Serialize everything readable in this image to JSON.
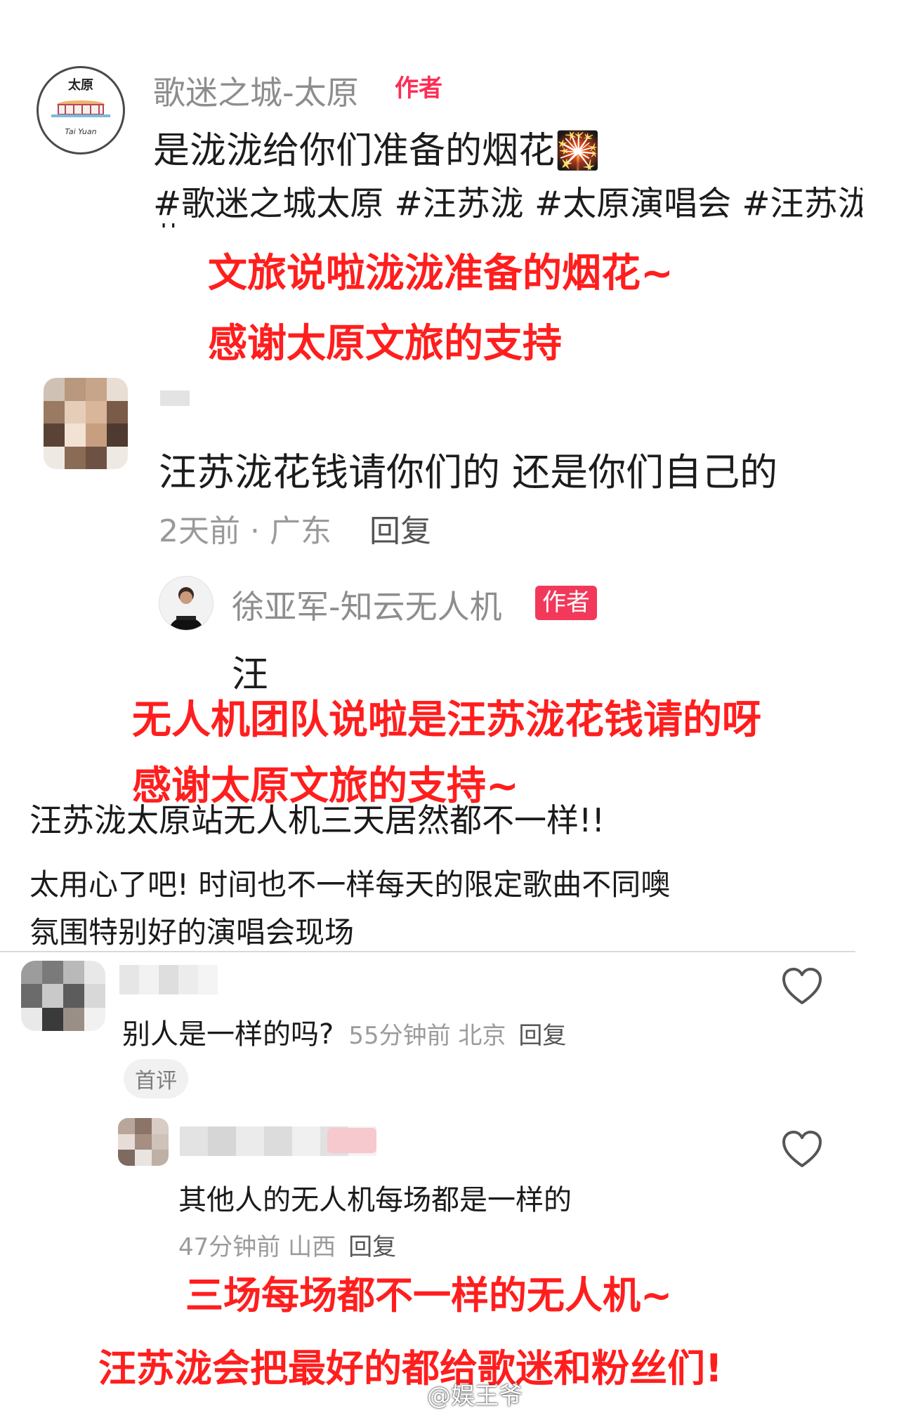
{
  "post": {
    "author": "歌迷之城-太原",
    "author_badge": "作者",
    "avatar_text_top": "太原",
    "avatar_text_bottom": "Tai Yuan",
    "text": "是泷泷给你们准备的烟花",
    "text_emoji": "🎇",
    "tags": "#歌迷之城太原 #汪苏泷 #太原演唱会 #汪苏泷",
    "tags_overflow": "艹"
  },
  "captions": {
    "c1": "文旅说啦泷泷准备的烟花~",
    "c2": "感谢太原文旅的支持",
    "c3": "无人机团队说啦是汪苏泷花钱请的呀",
    "c4": "感谢太原文旅的支持~",
    "c5": "三场每场都不一样的无人机~",
    "c6": "汪苏泷会把最好的都给歌迷和粉丝们!"
  },
  "comment1": {
    "text": "汪苏泷花钱请你们的 还是你们自己的",
    "meta": "2天前 · 广东",
    "reply": "回复"
  },
  "reply1": {
    "author": "徐亚军-知云无人机",
    "author_badge": "作者",
    "text": "汪"
  },
  "post2": {
    "line1": "汪苏泷太原站无人机三天居然都不一样!!",
    "line2": "太用心了吧! 时间也不一样每天的限定歌曲不同噢",
    "line3": "氛围特别好的演唱会现场"
  },
  "comment2": {
    "text": "别人是一样的吗?",
    "meta": "55分钟前 北京",
    "reply": "回复",
    "first_tag": "首评"
  },
  "reply2": {
    "text": "其他人的无人机每场都是一样的",
    "meta": "47分钟前 山西",
    "reply": "回复"
  },
  "watermark": "@娱王爷",
  "colors": {
    "caption_red": "#ff1e1e",
    "badge_red": "#f2395b",
    "meta_gray": "#9a9a9a"
  }
}
